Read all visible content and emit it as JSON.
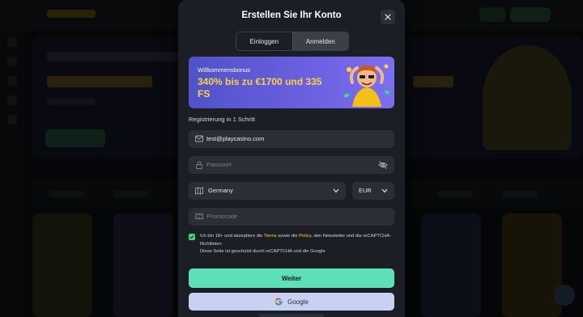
{
  "modal": {
    "title": "Erstellen Sie Ihr Konto",
    "tabs": [
      {
        "label": "Einloggen",
        "active": false
      },
      {
        "label": "Anmelden",
        "active": true
      }
    ]
  },
  "banner": {
    "subtitle": "Willkommensbonus",
    "headline": "340% bis zu €1700 und 335 FS"
  },
  "form": {
    "section_label": "Registrierung in 1 Schritt",
    "email_value": "test@playcasino.com",
    "password_placeholder": "Passwort",
    "country_value": "Germany",
    "currency_value": "EUR",
    "promo_placeholder": "Promocode"
  },
  "consent": {
    "checked": true,
    "part1": "Ich bin 18+ und akzeptiere die ",
    "terms": "Terms",
    "part2": " sowie die ",
    "policy": "Policy",
    "part3": ", den Newsletter und die reCAPTCHA-Richtlinien",
    "recaptcha_note": "Diese Seite ist geschützt durch reCAPTCHA und die Google"
  },
  "actions": {
    "primary_label": "Weiter",
    "google_label": "Google"
  },
  "icons": {
    "close": "close-icon",
    "email": "mail-icon",
    "password": "lock-icon",
    "password_toggle": "eye-off-icon",
    "country": "map-icon",
    "promo": "ticket-icon",
    "google": "google-icon",
    "chevron": "chevron-down-icon",
    "check": "check-icon"
  },
  "colors": {
    "modal_bg": "#1b1e24",
    "field_bg": "#2a2e36",
    "banner_gradient_start": "#4f52c8",
    "banner_gradient_end": "#7c6ff0",
    "accent_yellow": "#ffd23a",
    "primary_button": "#5de0b6",
    "google_button": "#c9d1f2",
    "checkbox": "#3ddc84"
  }
}
